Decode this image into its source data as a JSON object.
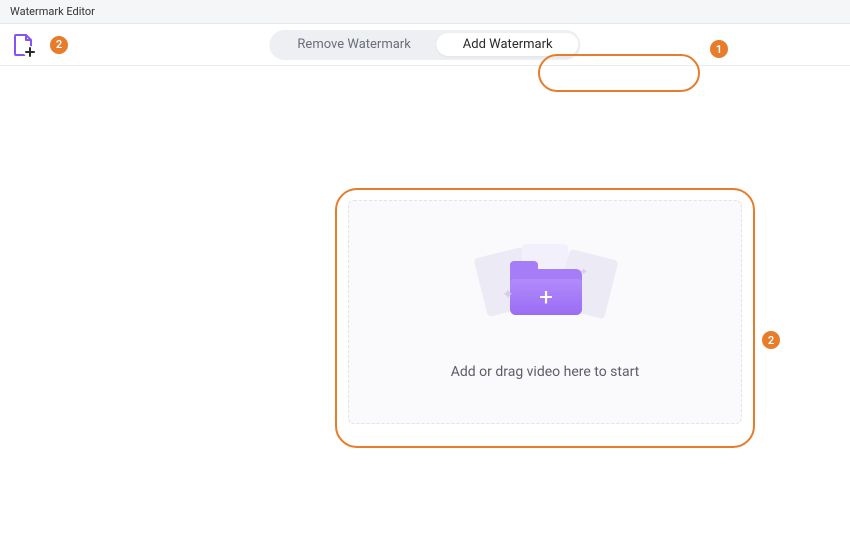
{
  "window": {
    "title": "Watermark Editor"
  },
  "toolbar": {
    "add_file_icon": "file-plus-icon"
  },
  "tabs": {
    "remove": "Remove Watermark",
    "add": "Add Watermark"
  },
  "dropzone": {
    "prompt": "Add or drag video here to start"
  },
  "callouts": {
    "step1": "1",
    "step2a": "2",
    "step2b": "2"
  }
}
